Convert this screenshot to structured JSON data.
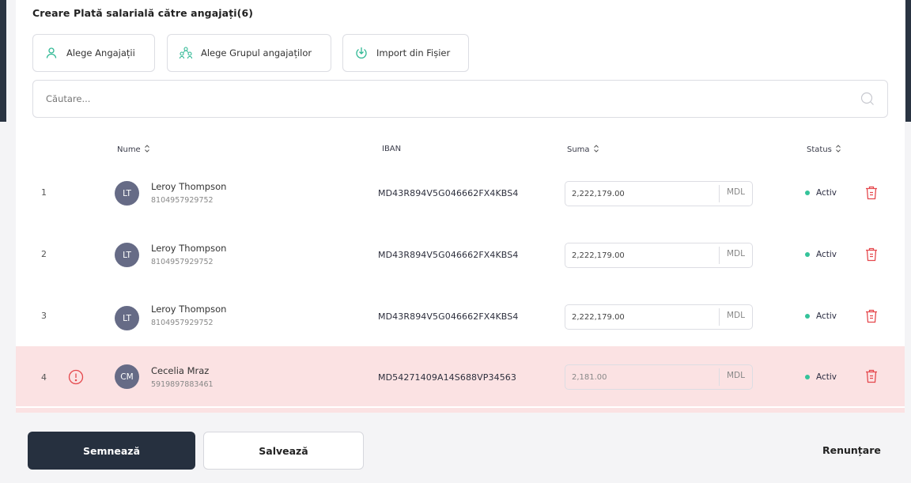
{
  "header": {
    "title": "Creare Plată salarială către angajați(6)"
  },
  "actions": {
    "choose_employees": "Alege Angajații",
    "choose_group": "Alege Grupul angajaților",
    "import_file": "Import din Fișier"
  },
  "search": {
    "placeholder": "Căutare..."
  },
  "table": {
    "columns": {
      "name": "Nume",
      "iban": "IBAN",
      "amount": "Suma",
      "status": "Status"
    },
    "rows": [
      {
        "index": "1",
        "initials": "LT",
        "name": "Leroy Thompson",
        "id": "8104957929752",
        "iban": "MD43R894V5G046662FX4KBS4",
        "amount": "2,222,179.00",
        "currency": "MDL",
        "status": "Activ",
        "error": false
      },
      {
        "index": "2",
        "initials": "LT",
        "name": "Leroy Thompson",
        "id": "8104957929752",
        "iban": "MD43R894V5G046662FX4KBS4",
        "amount": "2,222,179.00",
        "currency": "MDL",
        "status": "Activ",
        "error": false
      },
      {
        "index": "3",
        "initials": "LT",
        "name": "Leroy Thompson",
        "id": "8104957929752",
        "iban": "MD43R894V5G046662FX4KBS4",
        "amount": "2,222,179.00",
        "currency": "MDL",
        "status": "Activ",
        "error": false
      },
      {
        "index": "4",
        "initials": "CM",
        "name": "Cecelia Mraz",
        "id": "5919897883461",
        "iban": "MD54271409A14S688VP34563",
        "amount": "2,181.00",
        "currency": "MDL",
        "status": "Activ",
        "error": true
      }
    ]
  },
  "footer": {
    "sign": "Semnează",
    "save": "Salvează",
    "cancel": "Renunțare"
  },
  "colors": {
    "primary_dark": "#26303f",
    "status_active": "#34c39a",
    "error_row": "#fbe2e3",
    "danger": "#e5484d",
    "avatar": "#666b86"
  }
}
